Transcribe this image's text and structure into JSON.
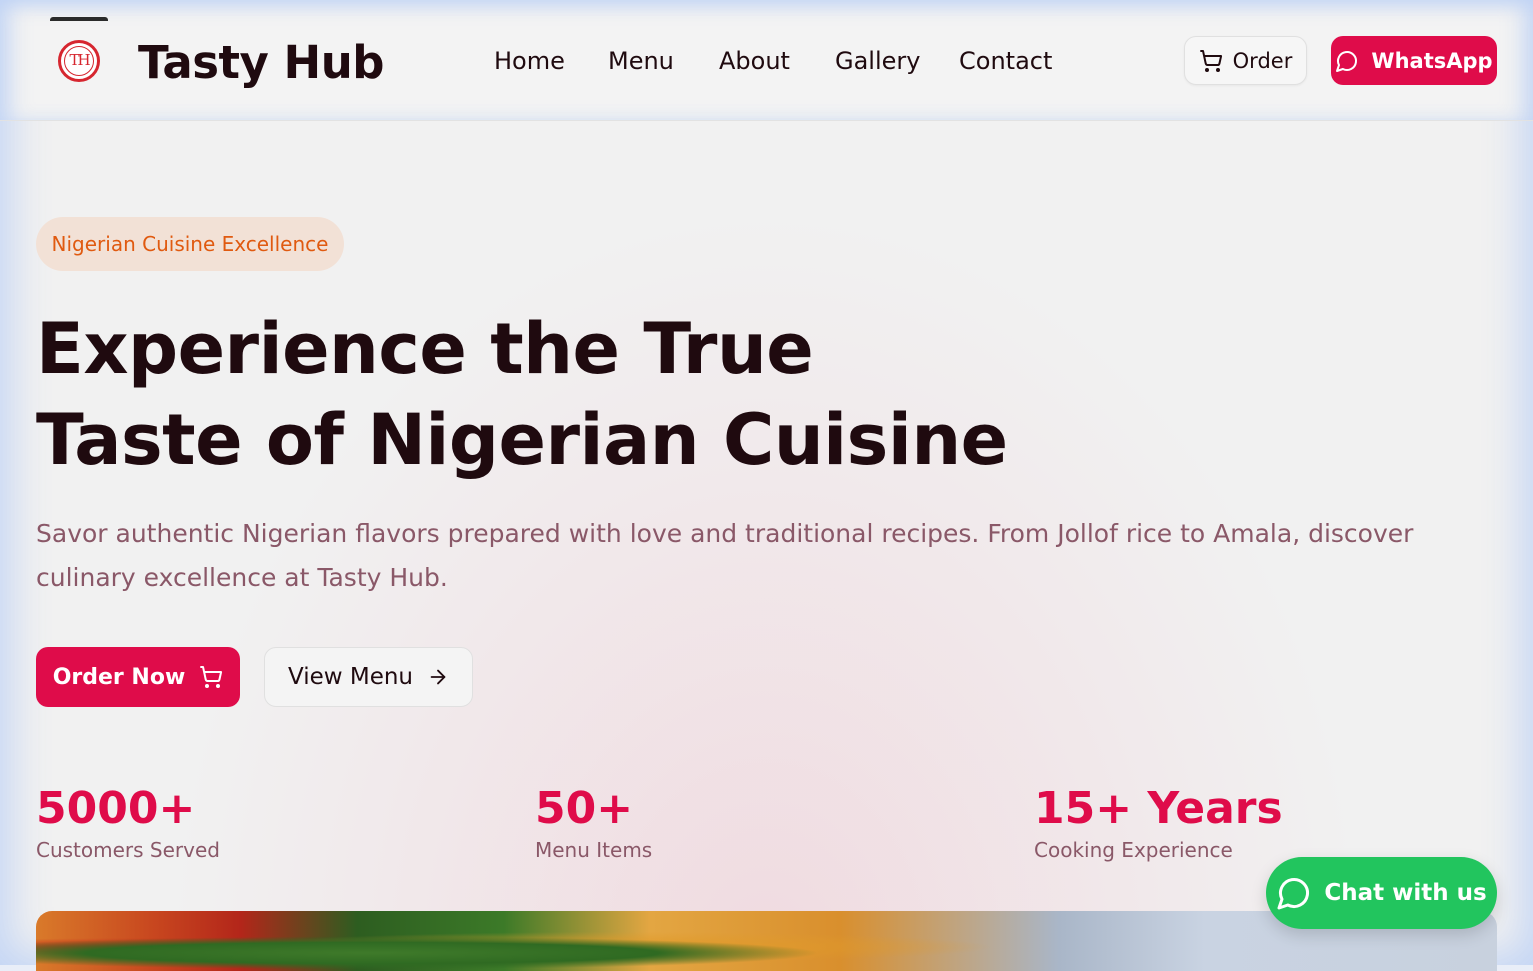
{
  "brand": {
    "logo_text": "TH",
    "name": "Tasty Hub"
  },
  "nav": {
    "items": [
      "Home",
      "Menu",
      "About",
      "Gallery",
      "Contact"
    ]
  },
  "header_actions": {
    "order_label": "Order",
    "order_icon": "cart-icon",
    "whatsapp_label": "WhatsApp",
    "whatsapp_icon": "chat-bubble-icon"
  },
  "hero": {
    "badge": "Nigerian Cuisine Excellence",
    "title_line1": "Experience the True",
    "title_line2": "Taste of Nigerian Cuisine",
    "description": "Savor authentic Nigerian flavors prepared with love and traditional recipes. From Jollof rice to Amala, discover culinary excellence at Tasty Hub.",
    "primary_cta": "Order Now",
    "primary_cta_icon": "cart-icon",
    "secondary_cta": "View Menu",
    "secondary_cta_icon": "arrow-right-icon"
  },
  "stats": [
    {
      "value": "5000+",
      "label": "Customers Served"
    },
    {
      "value": "50+",
      "label": "Menu Items"
    },
    {
      "value": "15+ Years",
      "label": "Cooking Experience"
    }
  ],
  "chat": {
    "label": "Chat with us",
    "icon": "chat-bubble-icon"
  },
  "colors": {
    "accent": "#df0c4a",
    "dark_text": "#1f0a0f",
    "muted_text": "#8a5868",
    "badge_bg": "#f2e1d6",
    "badge_text": "#e05a10",
    "chat_green": "#22c55e"
  }
}
